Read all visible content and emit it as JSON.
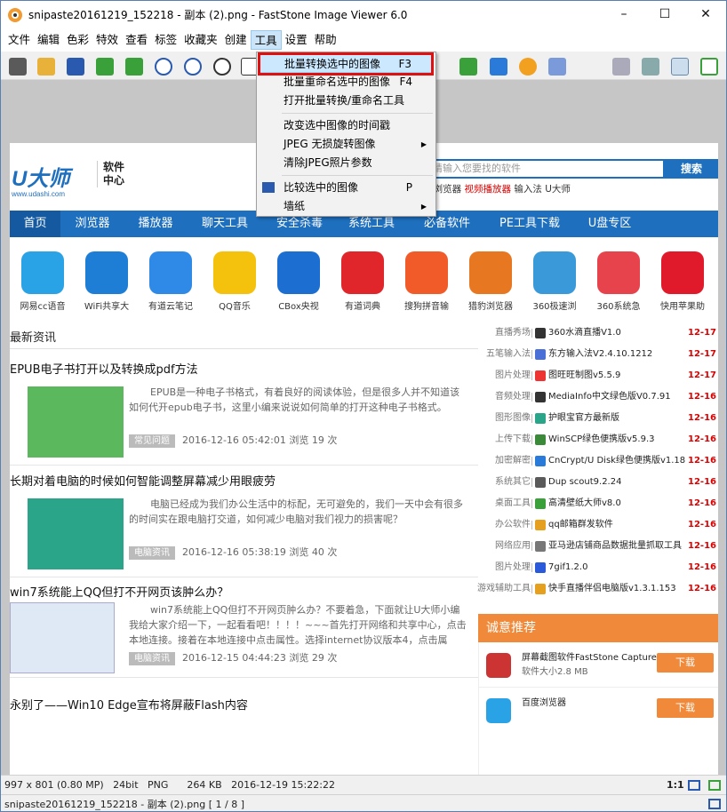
{
  "window": {
    "title": "snipaste20161219_152218 - 副本 (2).png - FastStone Image Viewer 6.0",
    "minimize_glyph": "–",
    "maximize_glyph": "☐",
    "close_glyph": "✕"
  },
  "menu": [
    "文件",
    "编辑",
    "色彩",
    "特效",
    "查看",
    "标签",
    "收藏夹",
    "创建",
    "工具",
    "设置",
    "帮助"
  ],
  "tools_menu": {
    "items": [
      {
        "label": "批量转换选中的图像",
        "key": "F3"
      },
      {
        "label": "批量重命名选中的图像",
        "key": "F4"
      },
      {
        "label": "打开批量转换/重命名工具",
        "key": ""
      },
      {
        "label": "改变选中图像的时间戳",
        "key": ""
      },
      {
        "label": "JPEG 无损旋转图像",
        "key": "",
        "submenu": true
      },
      {
        "label": "清除JPEG照片参数",
        "key": ""
      },
      {
        "label": "比较选中的图像",
        "key": "P"
      },
      {
        "label": "墙纸",
        "key": "",
        "submenu": true
      }
    ]
  },
  "status": {
    "info": "997 x 801 (0.80 MP)   24bit   PNG      264 KB   2016-12-19 15:22:22",
    "zoom": "1:1",
    "file": "snipaste20161219_152218 - 副本 (2).png [ 1 / 8 ]"
  },
  "site": {
    "logo": "U大师",
    "logo_sub": "www.udashi.com",
    "center_line1": "软件",
    "center_line2": "中心",
    "search_placeholder": "请输入您要找的软件",
    "search_btn": "搜索",
    "hot_prefix": "0浏览器",
    "hot_red": "视频播放器",
    "hot_rest": " 输入法 U大师",
    "nav": [
      "首页",
      "浏览器",
      "播放器",
      "聊天工具",
      "安全杀毒",
      "系统工具",
      "必备软件",
      "PE工具下载",
      "U盘专区"
    ],
    "apps": [
      {
        "name": "网易cc语音",
        "color": "#2aa3e6"
      },
      {
        "name": "WiFi共享大",
        "color": "#1e7ed6"
      },
      {
        "name": "有道云笔记",
        "color": "#2e8ae6"
      },
      {
        "name": "QQ音乐",
        "color": "#f4c20d"
      },
      {
        "name": "CBox央视",
        "color": "#1c6fd0"
      },
      {
        "name": "有道词典",
        "color": "#e0262b"
      },
      {
        "name": "搜狗拼音输",
        "color": "#f05b29"
      },
      {
        "name": "猎豹浏览器",
        "color": "#e87722"
      },
      {
        "name": "360极速浏",
        "color": "#3a9ad9"
      },
      {
        "name": "360系统急",
        "color": "#e6434d"
      },
      {
        "name": "快用苹果助",
        "color": "#e01a2b"
      }
    ],
    "section_title": "最新资讯",
    "articles": [
      {
        "title": "EPUB电子书打开以及转换成pdf方法",
        "desc": "EPUB是一种电子书格式，有着良好的阅读体验，但是很多人并不知道该如何代开epub电子书，这里小编来说说如何简单的打开这种电子书格式。",
        "tag": "常见问题",
        "meta": "2016-12-16 05:42:01   浏览 19 次",
        "color": "#5cb85c"
      },
      {
        "title": "长期对着电脑的时候如何智能调整屏幕减少用眼疲劳",
        "desc": "电脑已经成为我们办公生活中的标配，无可避免的，我们一天中会有很多的时间实在跟电脑打交道，如何减少电脑对我们视力的损害呢？",
        "tag": "电脑资讯",
        "meta": "2016-12-16 05:38:19   浏览 40 次",
        "color": "#2aa58a"
      },
      {
        "title": "win7系统能上QQ但打不开网页该肿么办？",
        "desc": "win7系统能上QQ但打不开网页肿么办？不要着急，下面就让U大师小编我给大家介绍一下，一起看看吧！！！！~~~首先打开网络和共享中心，点击本地连接。接着在本地连接中点击属性。选择internet协议版本4，点击属",
        "tag": "电脑资讯",
        "meta": "2016-12-15 04:44:23   浏览 29 次",
        "color": "#dfe9f5"
      },
      {
        "title": "永别了——Win10 Edge宣布将屏蔽Flash内容",
        "desc": "",
        "tag": "",
        "meta": "",
        "color": ""
      }
    ],
    "right_list": [
      {
        "cat": "直播秀场",
        "name": "360水滴直播V1.0",
        "date": "12-17",
        "color": "#333"
      },
      {
        "cat": "五笔输入法",
        "name": "东方输入法V2.4.10.1212",
        "date": "12-17",
        "color": "#4a6fd6"
      },
      {
        "cat": "图片处理",
        "name": "图旺旺制图v5.5.9",
        "date": "12-17",
        "color": "#e33"
      },
      {
        "cat": "音频处理",
        "name": "MediaInfo中文绿色版V0.7.91",
        "date": "12-16",
        "color": "#333"
      },
      {
        "cat": "图形图像",
        "name": "护眼宝官方最新版",
        "date": "12-16",
        "color": "#2aa58a"
      },
      {
        "cat": "上传下载",
        "name": "WinSCP绿色便携版v5.9.3",
        "date": "12-16",
        "color": "#3a8a3a"
      },
      {
        "cat": "加密解密",
        "name": "CnCrypt/U Disk绿色便携版v1.18",
        "date": "12-16",
        "color": "#2a7ad9"
      },
      {
        "cat": "系统其它",
        "name": "Dup scout9.2.24",
        "date": "12-16",
        "color": "#5a5a5a"
      },
      {
        "cat": "桌面工具",
        "name": "高清壁纸大师v8.0",
        "date": "12-16",
        "color": "#3aa03a"
      },
      {
        "cat": "办公软件",
        "name": "qq邮箱群发软件",
        "date": "12-16",
        "color": "#e6a020"
      },
      {
        "cat": "网络应用",
        "name": "亚马逊店铺商品数据批量抓取工具",
        "date": "12-16",
        "color": "#777"
      },
      {
        "cat": "图片处理",
        "name": "7gif1.2.0",
        "date": "12-16",
        "color": "#2a5ad9"
      },
      {
        "cat": "游戏辅助工具",
        "name": "快手直播伴侣电脑版v1.3.1.153",
        "date": "12-16",
        "color": "#e6a020"
      }
    ],
    "rec_title": "诚意推荐",
    "rec_items": [
      {
        "name": "屏幕截图软件FastStone Capture",
        "size": "软件大小2.8 MB",
        "btn": "下载",
        "color": "#c33"
      },
      {
        "name": "百度浏览器",
        "size": "",
        "btn": "下载",
        "color": "#2aa3e6"
      }
    ]
  }
}
